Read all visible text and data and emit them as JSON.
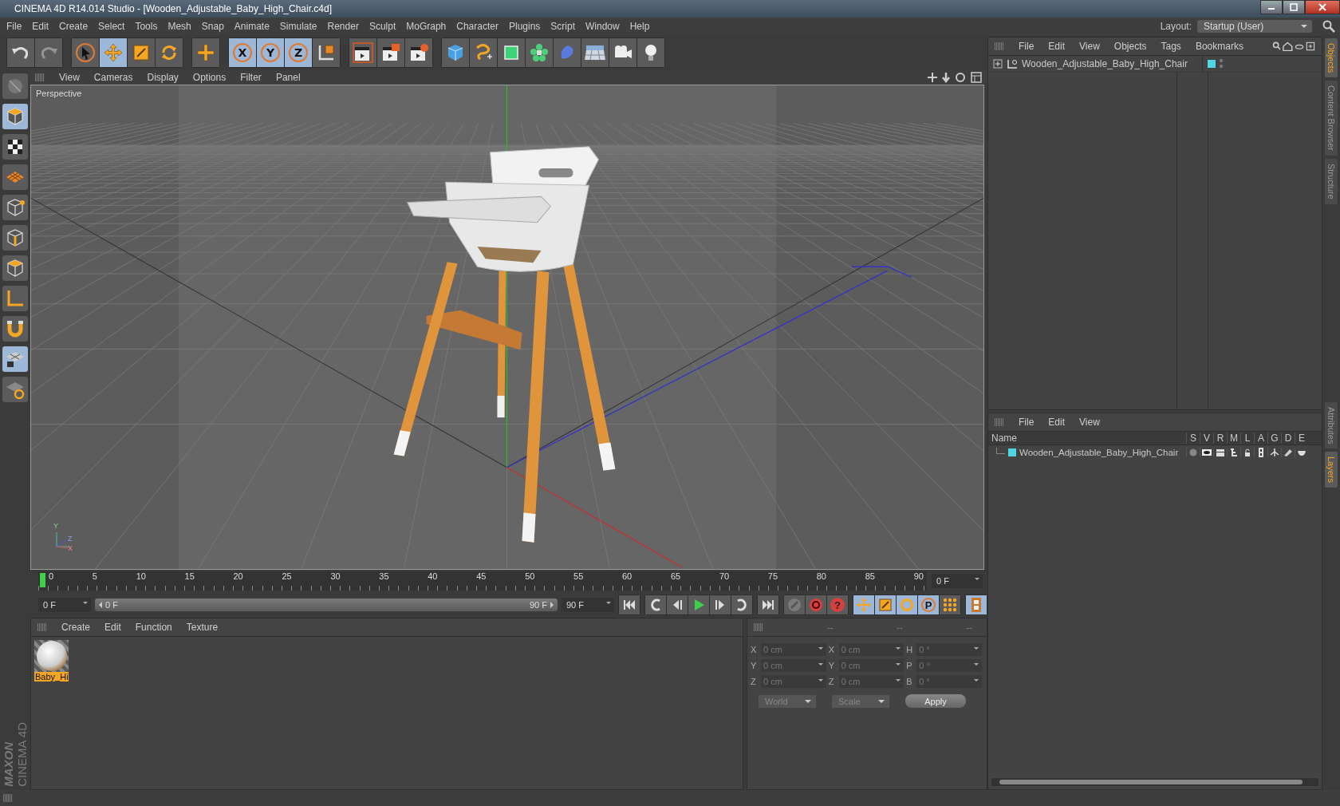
{
  "window": {
    "title": "CINEMA 4D R14.014 Studio - [Wooden_Adjustable_Baby_High_Chair.c4d]"
  },
  "menu_bar": [
    "File",
    "Edit",
    "Create",
    "Select",
    "Tools",
    "Mesh",
    "Snap",
    "Animate",
    "Simulate",
    "Render",
    "Sculpt",
    "MoGraph",
    "Character",
    "Plugins",
    "Script",
    "Window",
    "Help"
  ],
  "layout": {
    "label": "Layout:",
    "value": "Startup (User)"
  },
  "toolbar": [
    [
      {
        "kind": "undo",
        "selected": false,
        "disabled": false
      },
      {
        "kind": "redo",
        "selected": false,
        "disabled": true
      }
    ],
    [
      {
        "kind": "select",
        "selected": false,
        "disabled": false
      },
      {
        "kind": "move",
        "selected": true,
        "disabled": false
      },
      {
        "kind": "scale",
        "selected": false,
        "disabled": false
      },
      {
        "kind": "rotate",
        "selected": false,
        "disabled": false
      }
    ],
    [
      {
        "kind": "add",
        "selected": false,
        "disabled": false
      }
    ],
    [
      {
        "kind": "axis",
        "label": "X",
        "selected": true,
        "disabled": false
      },
      {
        "kind": "axis",
        "label": "Y",
        "selected": true,
        "disabled": false
      },
      {
        "kind": "axis",
        "label": "Z",
        "selected": true,
        "disabled": false
      },
      {
        "kind": "coord",
        "selected": false,
        "disabled": false
      }
    ],
    [
      {
        "kind": "render-view",
        "selected": false,
        "disabled": false
      },
      {
        "kind": "render-picture",
        "selected": false,
        "disabled": false
      },
      {
        "kind": "render-settings",
        "selected": false,
        "disabled": false
      }
    ],
    [
      {
        "kind": "cube",
        "selected": false,
        "disabled": false
      },
      {
        "kind": "spline",
        "selected": false,
        "disabled": false
      },
      {
        "kind": "subdivision",
        "selected": false,
        "disabled": false
      },
      {
        "kind": "cloner",
        "selected": false,
        "disabled": false
      },
      {
        "kind": "deformer",
        "selected": false,
        "disabled": false
      },
      {
        "kind": "floor",
        "selected": false,
        "disabled": false
      },
      {
        "kind": "camera",
        "selected": false,
        "disabled": false
      },
      {
        "kind": "light",
        "selected": false,
        "disabled": false
      }
    ]
  ],
  "left_tools": [
    {
      "kind": "view",
      "selected": false
    },
    {
      "kind": "model",
      "selected": true
    },
    {
      "kind": "texture",
      "selected": false
    },
    {
      "kind": "workplane",
      "selected": false
    },
    {
      "kind": "points",
      "selected": false
    },
    {
      "kind": "edges",
      "selected": false
    },
    {
      "kind": "polygons",
      "selected": false
    },
    {
      "kind": "axis",
      "selected": false
    },
    {
      "kind": "magnet",
      "selected": false
    },
    {
      "kind": "grid-lock",
      "selected": true
    },
    {
      "kind": "snap",
      "selected": false
    }
  ],
  "viewport": {
    "menu": [
      "View",
      "Cameras",
      "Display",
      "Options",
      "Filter",
      "Panel"
    ],
    "camera_label": "Perspective",
    "gizmo_labels": [
      "Y",
      "Z",
      "X"
    ]
  },
  "timeline": {
    "ticks": [
      "0",
      "5",
      "10",
      "15",
      "20",
      "25",
      "30",
      "35",
      "40",
      "45",
      "50",
      "55",
      "60",
      "65",
      "70",
      "75",
      "80",
      "85",
      "90"
    ],
    "playhead": {
      "level": 0
    },
    "frame_field": "0 F"
  },
  "transport": {
    "start_field": "0 F",
    "range": {
      "start_label": "0 F",
      "end_label": "90 F",
      "level": 1
    },
    "end_field": "90 F",
    "groups": [
      [
        {
          "kind": "to-start",
          "selected": false
        }
      ],
      [
        {
          "kind": "prev-key",
          "selected": false
        },
        {
          "kind": "prev-frame",
          "selected": false
        },
        {
          "kind": "play",
          "selected": false
        },
        {
          "kind": "next-frame",
          "selected": false
        },
        {
          "kind": "next-key",
          "selected": false
        }
      ],
      [
        {
          "kind": "to-end",
          "selected": false
        }
      ],
      [
        {
          "kind": "record",
          "selected": false
        },
        {
          "kind": "autokey",
          "selected": false
        },
        {
          "kind": "key-help",
          "label": "?",
          "selected": false
        }
      ],
      [
        {
          "kind": "move",
          "selected": true
        },
        {
          "kind": "scale",
          "selected": true
        },
        {
          "kind": "rotate",
          "selected": true
        },
        {
          "kind": "param",
          "label": "P",
          "selected": true
        },
        {
          "kind": "points",
          "selected": false
        }
      ],
      [
        {
          "kind": "film",
          "selected": true
        }
      ]
    ]
  },
  "materials": {
    "menu": [
      "Create",
      "Edit",
      "Function",
      "Texture"
    ],
    "items": [
      {
        "name": "Baby_Hi",
        "selected": true
      }
    ]
  },
  "coordinates": {
    "headers": [
      "--",
      "--",
      "--"
    ],
    "rows": [
      {
        "position_axis": "X",
        "position": "0 cm",
        "size_axis": "X",
        "size": "0 cm",
        "rotation_axis": "H",
        "rotation": "0 °"
      },
      {
        "position_axis": "Y",
        "position": "0 cm",
        "size_axis": "Y",
        "size": "0 cm",
        "rotation_axis": "P",
        "rotation": "0 °"
      },
      {
        "position_axis": "Z",
        "position": "0 cm",
        "size_axis": "Z",
        "size": "0 cm",
        "rotation_axis": "B",
        "rotation": "0 °"
      }
    ],
    "position_mode": "World",
    "size_mode": "Scale",
    "apply": "Apply"
  },
  "object_manager": {
    "menu": [
      "File",
      "Edit",
      "View",
      "Objects",
      "Tags",
      "Bookmarks"
    ],
    "objects": [
      {
        "name": "Wooden_Adjustable_Baby_High_Chair",
        "color": "#4fd6e4",
        "expanded": false
      }
    ]
  },
  "layer_manager": {
    "menu": [
      "File",
      "Edit",
      "View"
    ],
    "columns": [
      "Name",
      "S",
      "V",
      "R",
      "M",
      "L",
      "A",
      "G",
      "D",
      "E"
    ],
    "layers": [
      {
        "name": "Wooden_Adjustable_Baby_High_Chair",
        "color": "#4fd6e4"
      }
    ]
  },
  "side_tabs_top": [
    {
      "label": "Objects",
      "selected": true
    },
    {
      "label": "Content Browser",
      "selected": false
    },
    {
      "label": "Structure",
      "selected": false
    }
  ],
  "side_tabs_bottom": [
    {
      "label": "Attributes",
      "selected": false
    },
    {
      "label": "Layers",
      "selected": true
    }
  ],
  "logo": {
    "brand": "MAXON",
    "product": "CINEMA 4D"
  }
}
